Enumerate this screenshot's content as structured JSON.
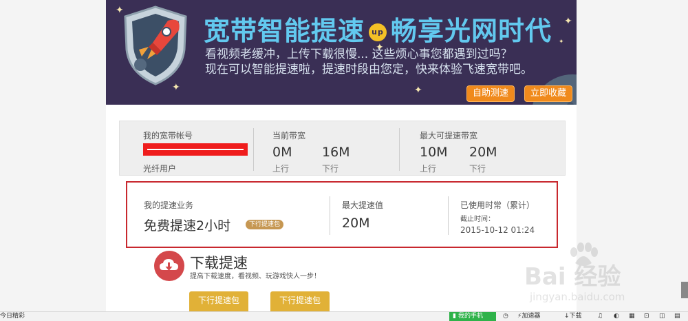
{
  "banner": {
    "title_part1": "宽带智能提速",
    "up_badge": "up",
    "title_part2": "畅享光网时代",
    "subtitle_line1": "看视频老缓冲，上传下载很慢...  这些烦心事您都遇到过吗？",
    "subtitle_line2": "现在可以智能提速啦，提速时段由您定，快来体验飞速宽带吧。",
    "btn_speedtest": "自助测速",
    "btn_bookmark": "立即收藏",
    "icon": "rocket-shield-icon"
  },
  "account": {
    "account_label": "我的宽带帐号",
    "account_value_redacted": true,
    "user_type": "光纤用户",
    "current_bw_label": "当前带宽",
    "current_up_value": "0M",
    "current_up_label": "上行",
    "current_down_value": "16M",
    "current_down_label": "下行",
    "max_bw_label": "最大可提速带宽",
    "max_up_value": "10M",
    "max_up_label": "上行",
    "max_down_value": "20M",
    "max_down_label": "下行"
  },
  "boost": {
    "service_label": "我的提速业务",
    "service_value": "免费提速2小时",
    "service_tag": "下行提速包",
    "max_label": "最大提速值",
    "max_value": "20M",
    "used_label": "已使用时常（累计）",
    "deadline_label": "截止时间：",
    "deadline_value": "2015-10-12 01:24"
  },
  "download": {
    "title": "下载提速",
    "subtitle": "提高下载速度，看视频、玩游戏快人一步！",
    "pkg1": "下行提速包",
    "pkg2": "下行提速包",
    "icon": "cloud-download-icon"
  },
  "watermark": {
    "brand": "Bai 经验",
    "url": "jingyan.baidu.com"
  },
  "taskbar": {
    "left_text": "今日精彩",
    "phone": "我的手机",
    "accelerator": "加速器",
    "download": "下载"
  },
  "colors": {
    "banner_bg": "#3a2f55",
    "title_blue": "#62c9ef",
    "orange_btn": "#f08a1c",
    "highlight_red": "#c8282e",
    "package_gold": "#e1b137",
    "download_red": "#d4484b"
  }
}
